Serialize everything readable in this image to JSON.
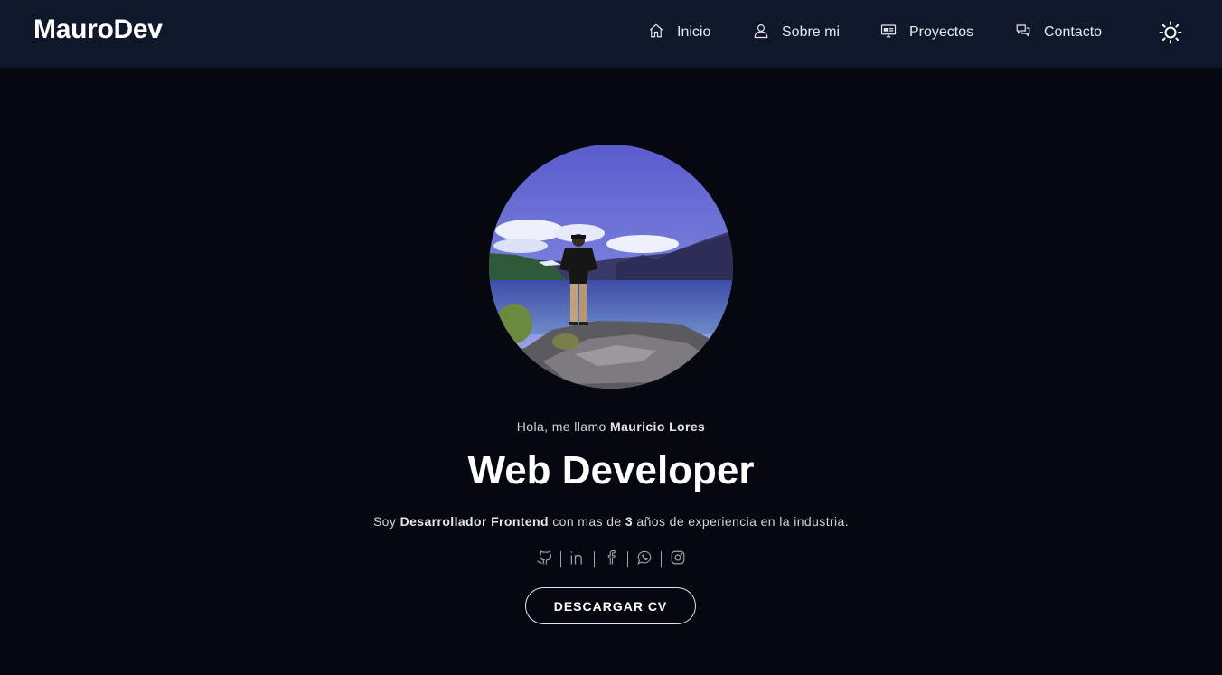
{
  "nav": {
    "brand": "MauroDev",
    "items": [
      {
        "label": "Inicio",
        "icon": "home-icon"
      },
      {
        "label": "Sobre mi",
        "icon": "user-icon"
      },
      {
        "label": "Proyectos",
        "icon": "monitor-icon"
      },
      {
        "label": "Contacto",
        "icon": "chat-icon"
      }
    ],
    "theme_toggle_icon": "sun-icon"
  },
  "hero": {
    "greeting_prefix": "Hola, me llamo ",
    "name": "Mauricio Lores",
    "title": "Web Developer",
    "desc_prefix": "Soy ",
    "desc_role": "Desarrollador Frontend",
    "desc_middle": " con mas de ",
    "desc_years": "3",
    "desc_suffix": " años de experiencia en la industria.",
    "socials": [
      "github-icon",
      "linkedin-icon",
      "facebook-icon",
      "whatsapp-icon",
      "instagram-icon"
    ],
    "cv_button": "DESCARGAR CV"
  },
  "colors": {
    "page_bg": "#05080f",
    "navbar_bg": "#0f172a",
    "text": "#e5e7eb"
  }
}
